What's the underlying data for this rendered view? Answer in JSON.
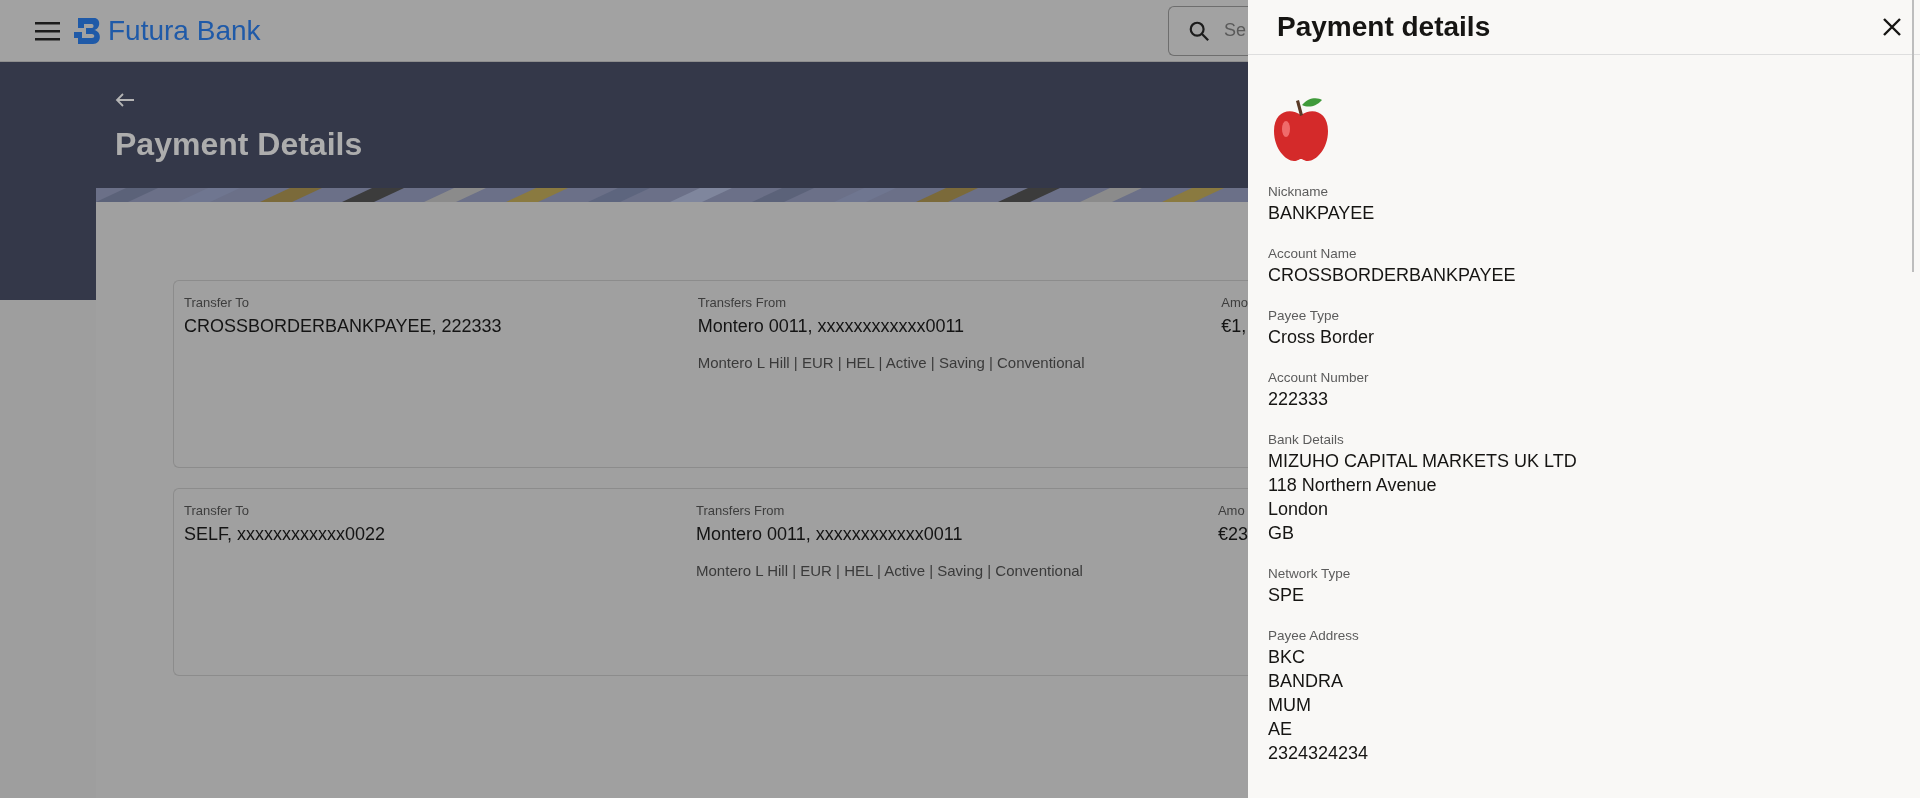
{
  "header": {
    "brand": "Futura Bank",
    "search": {
      "placeholder": "Se"
    }
  },
  "page": {
    "title": "Payment Details"
  },
  "payments": [
    {
      "transfer_to_label": "Transfer To",
      "transfer_to": "CROSSBORDERBANKPAYEE, 222333",
      "transfers_from_label": "Transfers From",
      "transfers_from": "Montero 0011, xxxxxxxxxxxx0011",
      "account_info": "Montero L Hill | EUR | HEL | Active | Saving | Conventional",
      "amount_label": "Amo",
      "amount": "€1,"
    },
    {
      "transfer_to_label": "Transfer To",
      "transfer_to": "SELF, xxxxxxxxxxxx0022",
      "transfers_from_label": "Transfers From",
      "transfers_from": "Montero 0011, xxxxxxxxxxxx0011",
      "account_info": "Montero L Hill | EUR | HEL | Active | Saving | Conventional",
      "amount_label": "Amo",
      "amount": "€23"
    }
  ],
  "drawer": {
    "title": "Payment details",
    "fields": [
      {
        "label": "Nickname",
        "lines": [
          "BANKPAYEE"
        ]
      },
      {
        "label": "Account Name",
        "lines": [
          "CROSSBORDERBANKPAYEE"
        ]
      },
      {
        "label": "Payee Type",
        "lines": [
          "Cross Border"
        ]
      },
      {
        "label": "Account Number",
        "lines": [
          "222333"
        ]
      },
      {
        "label": "Bank Details",
        "lines": [
          "MIZUHO CAPITAL MARKETS UK LTD",
          "118 Northern Avenue",
          "London",
          "GB"
        ]
      },
      {
        "label": "Network Type",
        "lines": [
          "SPE"
        ]
      },
      {
        "label": "Payee Address",
        "lines": [
          "BKC",
          "BANDRA",
          "MUM",
          "AE",
          "2324324234"
        ]
      }
    ]
  }
}
